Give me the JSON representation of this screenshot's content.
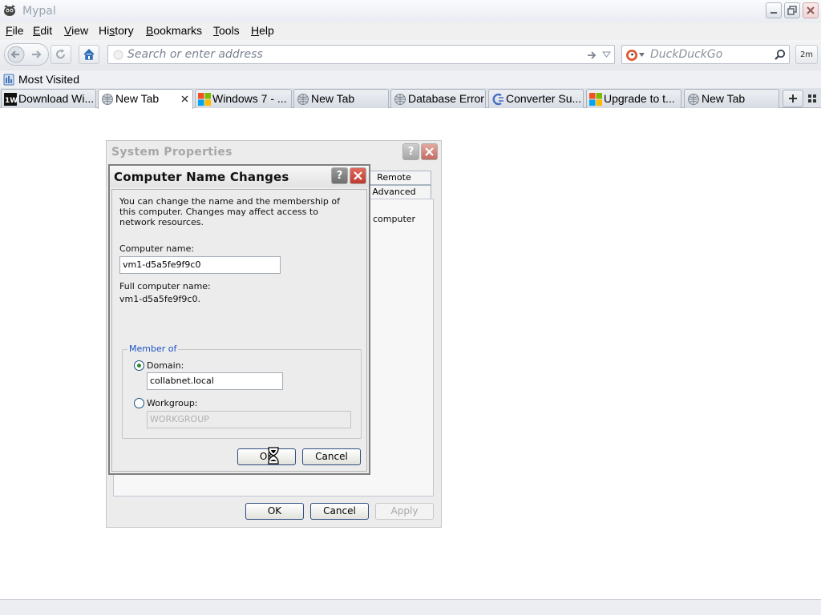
{
  "browser": {
    "title": "Mypal",
    "menu": [
      {
        "label": "File",
        "accel": "F"
      },
      {
        "label": "Edit",
        "accel": "E"
      },
      {
        "label": "View",
        "accel": "V"
      },
      {
        "label": "History",
        "accel": "s"
      },
      {
        "label": "Bookmarks",
        "accel": "B"
      },
      {
        "label": "Tools",
        "accel": "T"
      },
      {
        "label": "Help",
        "accel": "H"
      }
    ],
    "address_placeholder": "Search or enter address",
    "search_placeholder": "DuckDuckGo",
    "extension_badge": "2m",
    "bookmarks": {
      "most_visited": "Most Visited"
    },
    "tabs": [
      {
        "label": "Download Wi...",
        "icon": "tw-icon",
        "active": false
      },
      {
        "label": "New Tab",
        "icon": "globe-icon",
        "active": true
      },
      {
        "label": "Windows 7 - ...",
        "icon": "windows-icon",
        "active": false
      },
      {
        "label": "New Tab",
        "icon": "globe-icon",
        "active": false
      },
      {
        "label": "Database Error",
        "icon": "globe-icon",
        "active": false
      },
      {
        "label": "Converter Su...",
        "icon": "converter-icon",
        "active": false
      },
      {
        "label": "Upgrade to t...",
        "icon": "windows-icon",
        "active": false
      },
      {
        "label": "New Tab",
        "icon": "globe-icon",
        "active": false
      }
    ]
  },
  "system_properties": {
    "title": "System Properties",
    "tabs": [
      "Remote",
      "Advanced"
    ],
    "panel_text": "computer",
    "buttons": {
      "ok": "OK",
      "cancel": "Cancel",
      "apply": "Apply"
    }
  },
  "computer_name_changes": {
    "title": "Computer Name Changes",
    "intro": "You can change the name and the membership of this computer. Changes may affect access to network resources.",
    "computer_name_label": "Computer name:",
    "computer_name_value": "vm1-d5a5fe9f9c0",
    "full_name_label": "Full computer name:",
    "full_name_value": "vm1-d5a5fe9f9c0.",
    "member_of_label": "Member of",
    "domain_label": "Domain:",
    "domain_value": "collabnet.local",
    "domain_selected": true,
    "workgroup_label": "Workgroup:",
    "workgroup_value": "WORKGROUP",
    "ok_label": "OK",
    "cancel_label": "Cancel"
  }
}
